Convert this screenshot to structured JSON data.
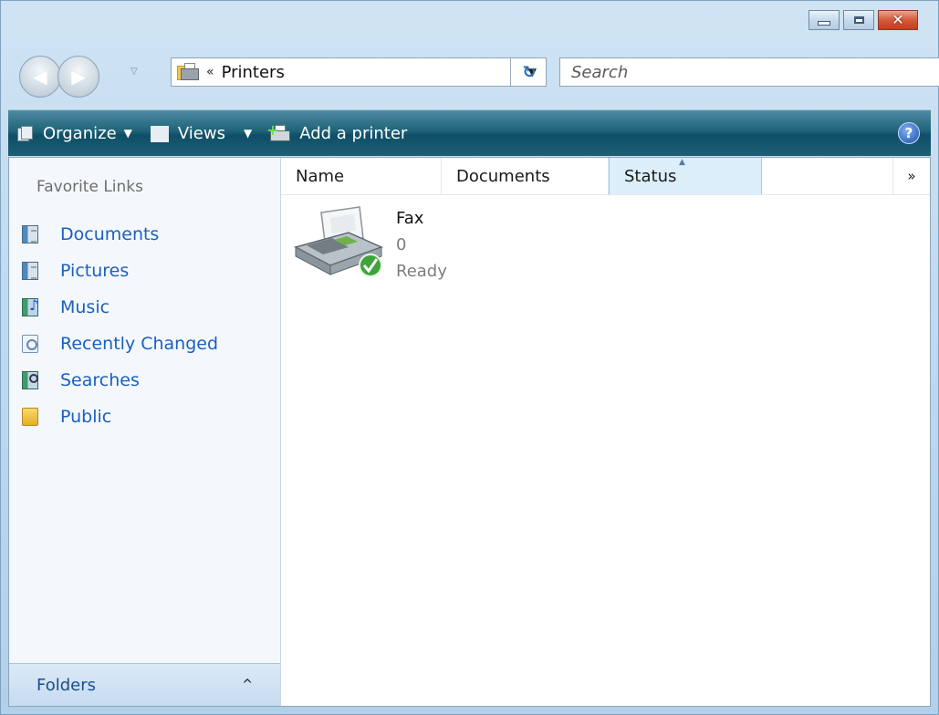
{
  "window": {
    "caption_buttons": [
      "minimize",
      "maximize",
      "close"
    ]
  },
  "address_bar": {
    "chevron": "«",
    "location": "Printers",
    "dropdown": "▼",
    "refresh_icon": "refresh-icon"
  },
  "search": {
    "placeholder": "Search"
  },
  "toolbar": {
    "organize": "Organize",
    "views": "Views",
    "add_printer": "Add a printer",
    "help": "?",
    "dropdown_arrow": "▼"
  },
  "navigation_pane": {
    "heading": "Favorite Links",
    "links": [
      {
        "label": "Documents",
        "icon": "documents-icon"
      },
      {
        "label": "Pictures",
        "icon": "pictures-icon"
      },
      {
        "label": "Music",
        "icon": "music-icon"
      },
      {
        "label": "Recently Changed",
        "icon": "recently-changed-icon"
      },
      {
        "label": "Searches",
        "icon": "searches-icon"
      },
      {
        "label": "Public",
        "icon": "public-folder-icon"
      }
    ],
    "folders_label": "Folders",
    "folders_caret": "^"
  },
  "columns": {
    "name": "Name",
    "documents": "Documents",
    "status": "Status",
    "more": "»"
  },
  "items": [
    {
      "name": "Fax",
      "documents": "0",
      "status": "Ready",
      "icon": "fax-ready-icon"
    }
  ],
  "colors": {
    "link": "#1a5fc0",
    "toolbar_top": "#4f8ba2",
    "toolbar_bottom": "#0e4f67",
    "status_col_bg": "#ddeefb",
    "close_button": "#d5593a"
  }
}
